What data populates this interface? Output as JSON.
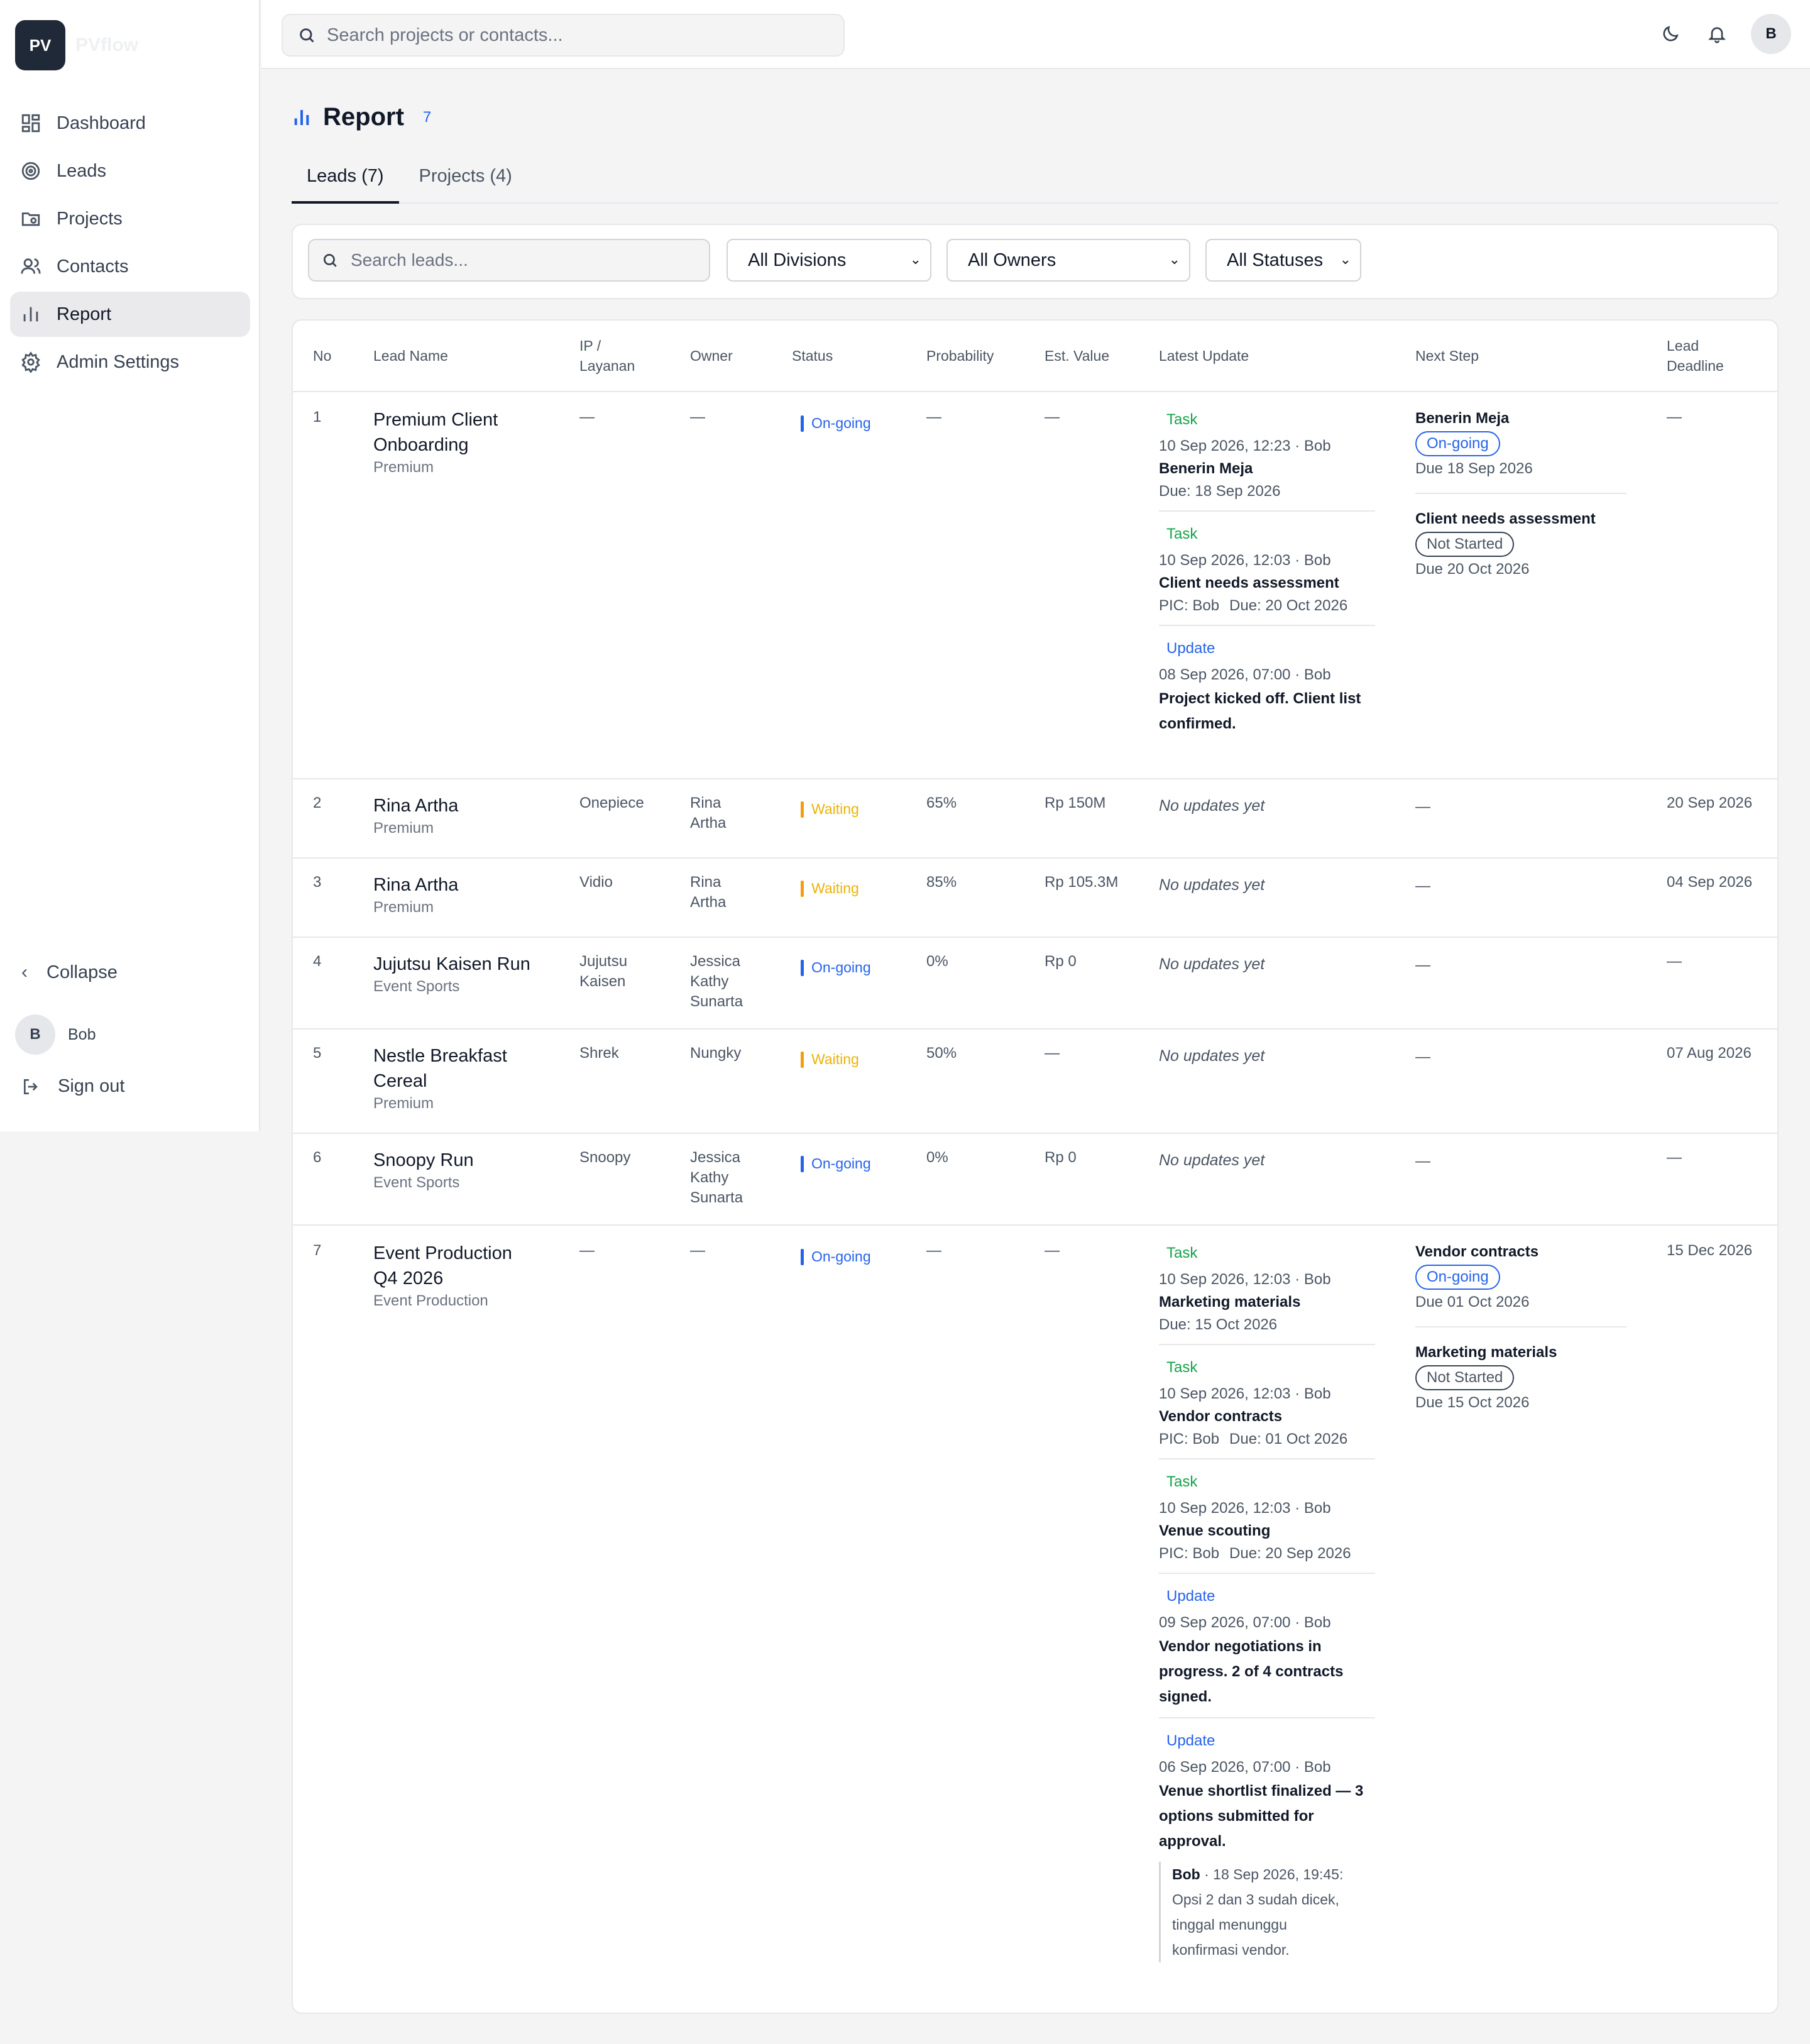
{
  "app": {
    "logo": "PV",
    "logo_text": "PVflow"
  },
  "sidebar": {
    "items": [
      {
        "label": "Dashboard",
        "icon": "dashboard-icon"
      },
      {
        "label": "Leads",
        "icon": "target-icon"
      },
      {
        "label": "Projects",
        "icon": "folder-icon"
      },
      {
        "label": "Contacts",
        "icon": "users-icon"
      },
      {
        "label": "Report",
        "icon": "bar-chart-icon",
        "active": true
      },
      {
        "label": "Admin Settings",
        "icon": "gear-icon"
      }
    ],
    "collapse_label": "Collapse",
    "user": {
      "initial": "B",
      "name": "Bob"
    },
    "signout_label": "Sign out"
  },
  "topbar": {
    "search_placeholder": "Search projects or contacts...",
    "avatar_initial": "B"
  },
  "page": {
    "title": "Report",
    "count": "7",
    "tabs": [
      {
        "label": "Leads (7)",
        "active": true
      },
      {
        "label": "Projects (4)",
        "active": false
      }
    ],
    "filters": {
      "search_placeholder": "Search leads...",
      "division": "All Divisions",
      "owner": "All Owners",
      "status": "All Statuses"
    }
  },
  "table": {
    "headers": {
      "no": "No",
      "lead_name": "Lead Name",
      "ip": [
        "IP /",
        "Layanan"
      ],
      "owner": "Owner",
      "status": "Status",
      "probability": "Probability",
      "est_value": "Est. Value",
      "latest_update": "Latest Update",
      "next_step": "Next Step",
      "deadline": [
        "Lead",
        "Deadline"
      ]
    },
    "rows": [
      {
        "no": "1",
        "name": [
          "Premium Client",
          "Onboarding"
        ],
        "division": "Premium",
        "ip": [
          "—"
        ],
        "owner": [
          "—"
        ],
        "status": "On-going",
        "status_kind": "ongoing",
        "probability": "—",
        "value": "—",
        "deadline": "—",
        "updates": [
          {
            "type": "Task",
            "kind": "task",
            "meta": "10 Sep 2026, 12:23 · Bob",
            "title": [
              "Benerin Meja"
            ],
            "sub": [
              "Due: 18 Sep 2026"
            ]
          },
          {
            "type": "Task",
            "kind": "task",
            "meta": "10 Sep 2026, 12:03 · Bob",
            "title": [
              "Client needs assessment"
            ],
            "sub": [
              "PIC: Bob",
              "Due: 20 Oct 2026"
            ]
          },
          {
            "type": "Update",
            "kind": "update",
            "meta": "08 Sep 2026, 07:00 · Bob",
            "title": [
              "Project kicked off. Client list",
              "confirmed."
            ],
            "sub": []
          }
        ],
        "next": [
          {
            "title": "Benerin Meja",
            "status": "On-going",
            "kind": "ongoing",
            "due": "Due 18 Sep 2026"
          },
          {
            "title": "Client needs assessment",
            "status": "Not Started",
            "kind": "notstarted",
            "due": "Due 20 Oct 2026"
          }
        ]
      },
      {
        "no": "2",
        "name": [
          "Rina Artha"
        ],
        "division": "Premium",
        "ip": [
          "Onepiece"
        ],
        "owner": [
          "Rina",
          "Artha"
        ],
        "status": "Waiting",
        "status_kind": "waiting",
        "probability": "65%",
        "value": "Rp 150M",
        "deadline": "20 Sep 2026",
        "no_updates": "No updates yet",
        "next_empty": "—"
      },
      {
        "no": "3",
        "name": [
          "Rina Artha"
        ],
        "division": "Premium",
        "ip": [
          "Vidio"
        ],
        "owner": [
          "Rina",
          "Artha"
        ],
        "status": "Waiting",
        "status_kind": "waiting",
        "probability": "85%",
        "value": "Rp 105.3M",
        "deadline": "04 Sep 2026",
        "no_updates": "No updates yet",
        "next_empty": "—"
      },
      {
        "no": "4",
        "name": [
          "Jujutsu Kaisen Run"
        ],
        "division": "Event Sports",
        "ip": [
          "Jujutsu",
          "Kaisen"
        ],
        "owner": [
          "Jessica",
          "Kathy",
          "Sunarta"
        ],
        "status": "On-going",
        "status_kind": "ongoing",
        "probability": "0%",
        "value": "Rp 0",
        "deadline": "—",
        "no_updates": "No updates yet",
        "next_empty": "—"
      },
      {
        "no": "5",
        "name": [
          "Nestle Breakfast",
          "Cereal"
        ],
        "division": "Premium",
        "ip": [
          "Shrek"
        ],
        "owner": [
          "Nungky"
        ],
        "status": "Waiting",
        "status_kind": "waiting",
        "probability": "50%",
        "value": "—",
        "deadline": "07 Aug 2026",
        "no_updates": "No updates yet",
        "next_empty": "—"
      },
      {
        "no": "6",
        "name": [
          "Snoopy Run"
        ],
        "division": "Event Sports",
        "ip": [
          "Snoopy"
        ],
        "owner": [
          "Jessica",
          "Kathy",
          "Sunarta"
        ],
        "status": "On-going",
        "status_kind": "ongoing",
        "probability": "0%",
        "value": "Rp 0",
        "deadline": "—",
        "no_updates": "No updates yet",
        "next_empty": "—"
      },
      {
        "no": "7",
        "name": [
          "Event Production",
          "Q4 2026"
        ],
        "division": "Event Production",
        "ip": [
          "—"
        ],
        "owner": [
          "—"
        ],
        "status": "On-going",
        "status_kind": "ongoing",
        "probability": "—",
        "value": "—",
        "deadline": "15 Dec 2026",
        "updates": [
          {
            "type": "Task",
            "kind": "task",
            "meta": "10 Sep 2026, 12:03 · Bob",
            "title": [
              "Marketing materials"
            ],
            "sub": [
              "Due: 15 Oct 2026"
            ]
          },
          {
            "type": "Task",
            "kind": "task",
            "meta": "10 Sep 2026, 12:03 · Bob",
            "title": [
              "Vendor contracts"
            ],
            "sub": [
              "PIC: Bob",
              "Due: 01 Oct 2026"
            ]
          },
          {
            "type": "Task",
            "kind": "task",
            "meta": "10 Sep 2026, 12:03 · Bob",
            "title": [
              "Venue scouting"
            ],
            "sub": [
              "PIC: Bob",
              "Due: 20 Sep 2026"
            ]
          },
          {
            "type": "Update",
            "kind": "update",
            "meta": "09 Sep 2026, 07:00 · Bob",
            "title": [
              "Vendor negotiations in",
              "progress. 2 of 4 contracts",
              "signed."
            ],
            "sub": []
          },
          {
            "type": "Update",
            "kind": "update",
            "meta": "06 Sep 2026, 07:00 · Bob",
            "title": [
              "Venue shortlist finalized — 3",
              "options submitted for",
              "approval."
            ],
            "sub": [],
            "comment": {
              "author": "Bob",
              "when": " · 18 Sep 2026, 19:45:",
              "lines": [
                "Opsi 2 dan 3 sudah dicek,",
                "tinggal menunggu",
                "konfirmasi vendor."
              ]
            }
          }
        ],
        "next": [
          {
            "title": "Vendor contracts",
            "status": "On-going",
            "kind": "ongoing",
            "due": "Due 01 Oct 2026"
          },
          {
            "title": "Marketing materials",
            "status": "Not Started",
            "kind": "notstarted",
            "due": "Due 15 Oct 2026"
          }
        ]
      }
    ]
  }
}
